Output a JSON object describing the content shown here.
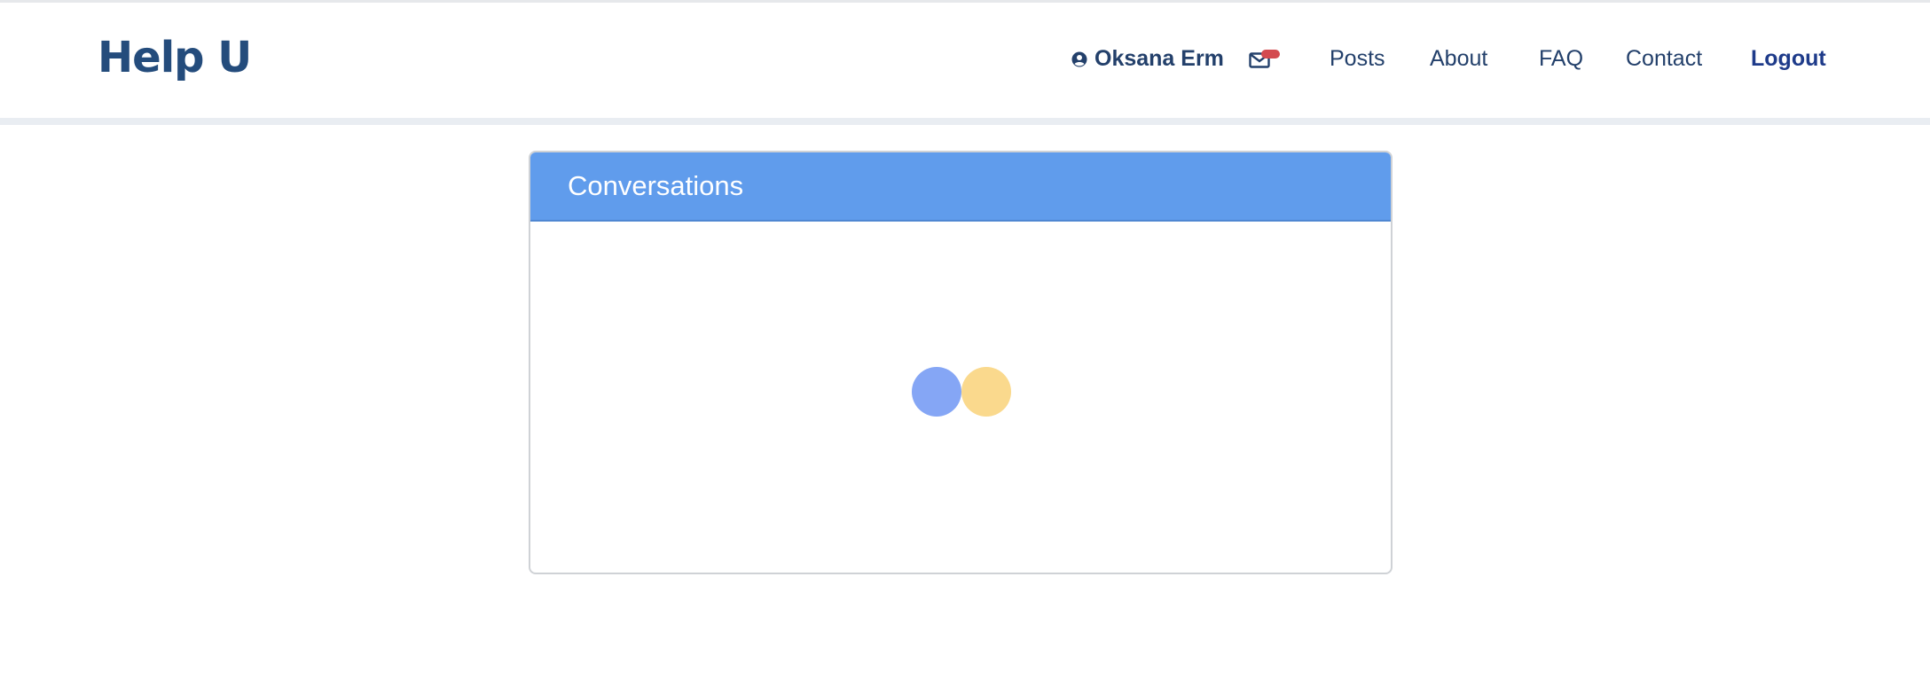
{
  "brand": {
    "name": "Help U"
  },
  "nav": {
    "user_icon": "user-circle-icon",
    "user_name": "Oksana Erm",
    "mail_icon": "envelope-icon",
    "links": [
      {
        "label": "Posts"
      },
      {
        "label": "About"
      },
      {
        "label": "FAQ"
      },
      {
        "label": "Contact"
      },
      {
        "label": "Logout"
      }
    ]
  },
  "conversations": {
    "title": "Conversations",
    "loading_indicator": "loading-dots-icon"
  },
  "colors": {
    "brand": "#244c7c",
    "nav_text": "#23406b",
    "logout": "#1e3b8a",
    "card_header": "#609cec",
    "badge": "#d34a4f",
    "loader_blue": "#85a6f5",
    "loader_yellow": "#fad98d"
  }
}
